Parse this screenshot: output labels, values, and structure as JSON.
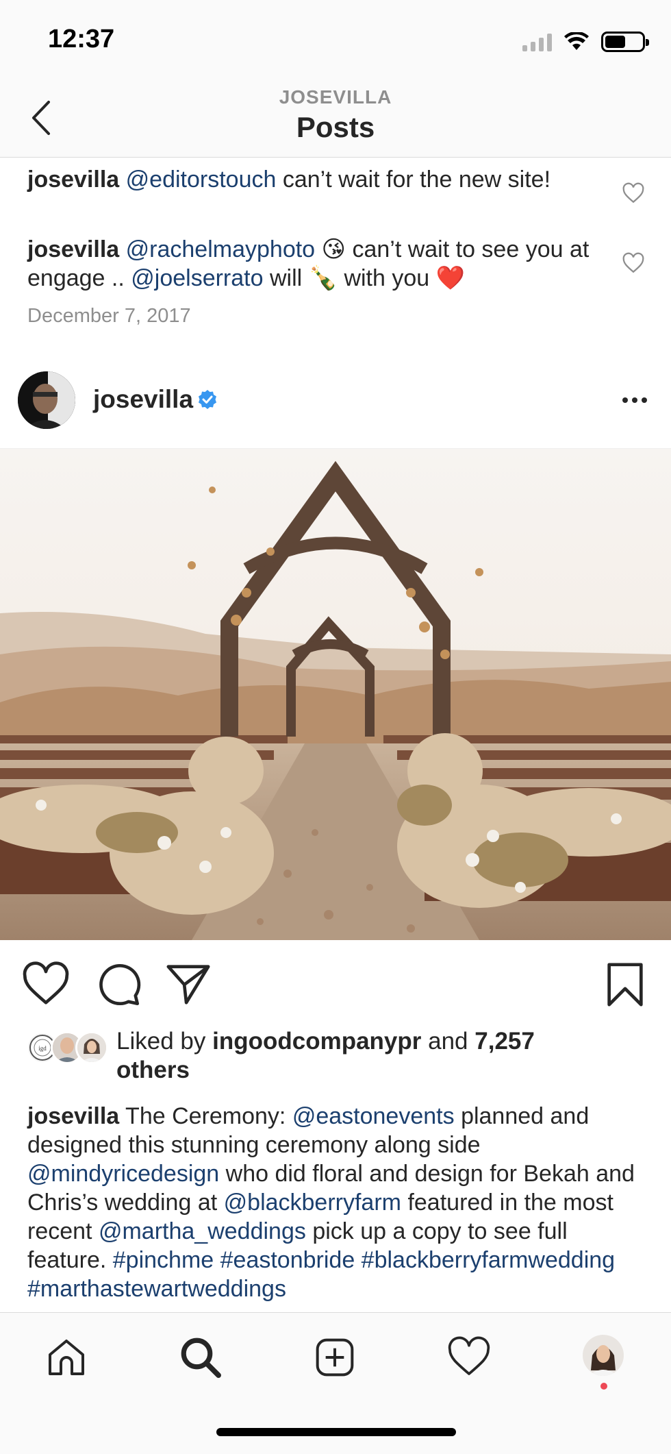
{
  "status_bar": {
    "time": "12:37",
    "icons": [
      "signal-icon",
      "wifi-icon",
      "battery-icon"
    ]
  },
  "header": {
    "account": "JOSEVILLA",
    "title": "Posts",
    "back_icon": "chevron-left-icon"
  },
  "comments": [
    {
      "user": "josevilla",
      "mention": "@editorstouch",
      "text": "can’t wait for the new site!"
    },
    {
      "user": "josevilla",
      "mention1": "@rachelmayphoto",
      "emoji1": "😘",
      "text1": "can’t wait to see you at engage ..",
      "mention2": "@joelserrato",
      "text2": "will",
      "emoji2": "🍾",
      "text3": "with you",
      "emoji3": "❤️"
    }
  ],
  "post_date": "December 7, 2017",
  "post": {
    "username": "josevilla",
    "verified": true,
    "more_icon": "more-horizontal-icon",
    "photo": "outdoor wooden arch ceremony aisle with dried flowers",
    "actions": [
      "heart-icon",
      "comment-icon",
      "share-icon",
      "bookmark-icon"
    ],
    "likes": {
      "prefix": "Liked by",
      "liker": "ingoodcompanypr",
      "middle": "and",
      "count": "7,257 others"
    },
    "caption": {
      "user": "josevilla",
      "parts": [
        "The Ceremony:",
        "@eastonevents",
        "planned and designed this stunning ceremony along side",
        "@mindyricedesign",
        "who did floral and design for Bekah and Chris’s wedding at",
        "@blackberryfarm",
        "featured in the most recent",
        "@martha_weddings",
        "pick up a copy to see full feature.",
        "#pinchme #eastonbride #blackberryfarmwedding #marthastewartweddings"
      ]
    }
  },
  "colors": {
    "mention": "#1b3f6e",
    "text": "#262626",
    "muted": "#8e8e8e",
    "verified": "#3897f0",
    "notification": "#ed4956"
  },
  "tab_bar": [
    "home-icon",
    "search-icon",
    "new-post-icon",
    "activity-icon",
    "profile-avatar"
  ]
}
